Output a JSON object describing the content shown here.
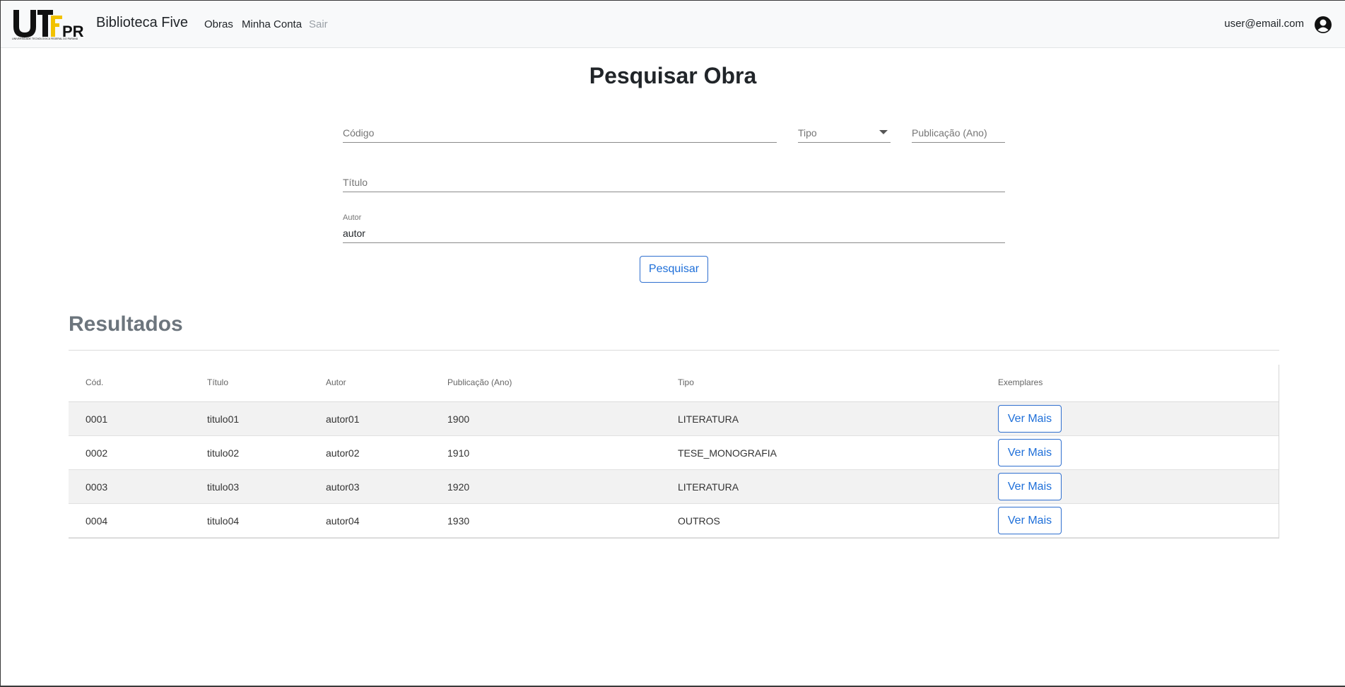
{
  "navbar": {
    "logo_text": "UTFPR",
    "logo_subtext": "UNIVERSIDADE TECNOLÓGICA FEDERAL DO PARANÁ",
    "brand": "Biblioteca Five",
    "links": [
      "Obras",
      "Minha Conta",
      "Sair"
    ],
    "user_email": "user@email.com",
    "user_icon": "user-circle-icon"
  },
  "search": {
    "title": "Pesquisar Obra",
    "codigo_placeholder": "Código",
    "tipo_placeholder": "Tipo",
    "publicacao_placeholder": "Publicação (Ano)",
    "titulo_placeholder": "Título",
    "autor_label": "Autor",
    "autor_value": "autor",
    "submit_label": "Pesquisar"
  },
  "results": {
    "title": "Resultados",
    "columns": [
      "Cód.",
      "Título",
      "Autor",
      "Publicação (Ano)",
      "Tipo",
      "Exemplares"
    ],
    "rows": [
      {
        "cod": "0001",
        "titulo": "titulo01",
        "autor": "autor01",
        "ano": "1900",
        "tipo": "LITERATURA",
        "action": "Ver Mais"
      },
      {
        "cod": "0002",
        "titulo": "titulo02",
        "autor": "autor02",
        "ano": "1910",
        "tipo": "TESE_MONOGRAFIA",
        "action": "Ver Mais"
      },
      {
        "cod": "0003",
        "titulo": "titulo03",
        "autor": "autor03",
        "ano": "1920",
        "tipo": "LITERATURA",
        "action": "Ver Mais"
      },
      {
        "cod": "0004",
        "titulo": "titulo04",
        "autor": "autor04",
        "ano": "1930",
        "tipo": "OUTROS",
        "action": "Ver Mais"
      }
    ]
  },
  "colors": {
    "accent": "#1e6fd9",
    "logo_yellow": "#f2c200",
    "navbar_bg": "#f8f9fa",
    "results_title": "#6c757d"
  }
}
